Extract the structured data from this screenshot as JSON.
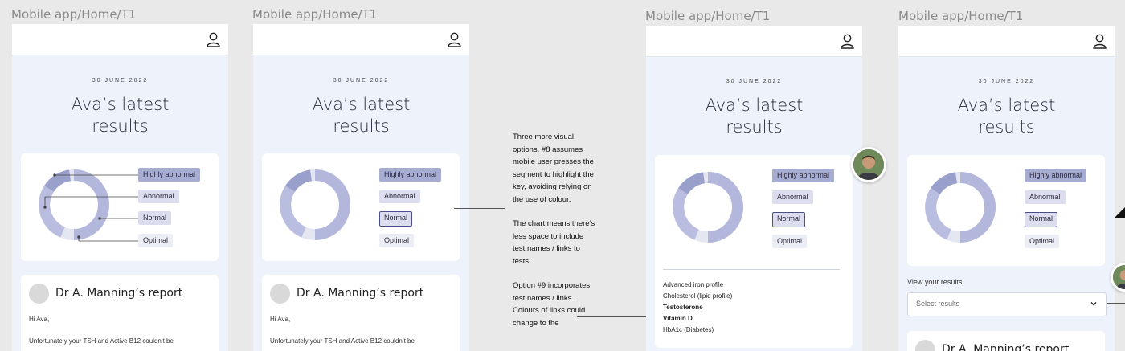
{
  "frame_label": "Mobile app/Home/T1",
  "screen": {
    "date": "30 JUNE 2022",
    "title_line1": "Ava’s latest",
    "title_line2": "results"
  },
  "legend": {
    "highly_abnormal": "Highly abnormal",
    "abnormal": "Abnormal",
    "normal": "Normal",
    "optimal": "Optimal"
  },
  "report": {
    "title": "Dr A. Manning’s report",
    "greeting": "Hi Ava,",
    "body": "Unfortunately your TSH and Active B12 couldn’t be"
  },
  "annotation": {
    "para1": "Three more visual options. #8 assumes mobile user presses the segment to highlight the key, avoiding relying on the use of colour.",
    "para2": "The chart means there’s less space to include test names / links to tests.",
    "para3": "Option #9 incorporates test names / links. Colours of links could change to the"
  },
  "tests": [
    "Advanced iron profile",
    "Cholesterol (lipid profile)",
    "Testosterone",
    "Vitamin D",
    "HbA1c (Diabetes)"
  ],
  "view_results": {
    "label": "View your results",
    "placeholder": "Select results"
  },
  "colors": {
    "highly_abnormal": "#9aa0cc",
    "abnormal": "#b9bde0",
    "normal": "#b3b7dc",
    "optimal": "#e4e6f1",
    "background": "#eef3fb"
  },
  "icons": [
    "profile-icon",
    "chevron-down-icon"
  ]
}
